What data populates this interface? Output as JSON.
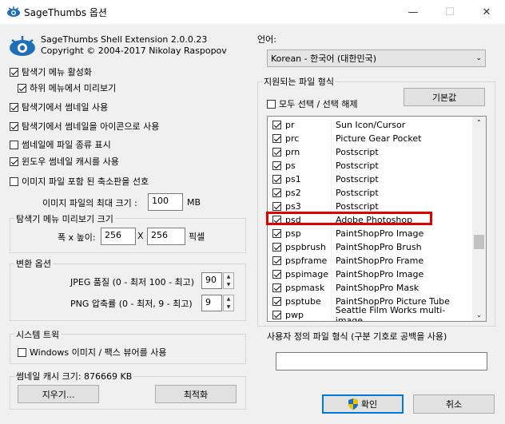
{
  "window": {
    "title": "SageThumbs 옵션",
    "minimize": "—",
    "maximize": "☐",
    "close": "✕"
  },
  "header": {
    "product": "SageThumbs Shell Extension 2.0.0.23",
    "copyright": "Copyright © 2004-2017 Nikolay Raspopov"
  },
  "options": {
    "enable_menu": {
      "label": "탐색기 메뉴 활성화",
      "checked": true
    },
    "submenu_preview": {
      "label": "하위 메뉴에서 미리보기",
      "checked": true
    },
    "use_thumbnails": {
      "label": "탐색기에서 썸네일 사용",
      "checked": true
    },
    "thumb_as_icons": {
      "label": "탐색기에서 썸네일을 아이콘으로 사용",
      "checked": true
    },
    "show_filetype": {
      "label": "썸네일에 파일 종류 표시",
      "checked": false
    },
    "windows_cache": {
      "label": "윈도우 썸네일 캐시를 사용",
      "checked": true
    },
    "prefer_embedded": {
      "label": "이미지 파일 포함 된 축소판을 선호",
      "checked": false
    }
  },
  "max_size": {
    "label": "이미지 파일의 최대 크기 :",
    "value": "100",
    "unit": "MB"
  },
  "preview_group": {
    "title": "탐색기 메뉴 미리보기 크기",
    "label": "폭 x 높이:",
    "width": "256",
    "x": "X",
    "height": "256",
    "unit": "픽셀"
  },
  "convert_group": {
    "title": "변환 옵션",
    "jpeg_label": "JPEG 품질 (0 - 최저 100 - 최고)",
    "jpeg_value": "90",
    "png_label": "PNG 압축률 (0 - 최저, 9 - 최고)",
    "png_value": "9"
  },
  "system_group": {
    "title": "시스템 트윅",
    "wiv": {
      "label": "Windows 이미지 / 팩스 뷰어를 사용",
      "checked": false
    }
  },
  "cache": {
    "label": "썸네일 캐시 크기: 876669 KB",
    "clear": "지우기...",
    "optimize": "최적화"
  },
  "language": {
    "label": "언어:",
    "value": "Korean - 한국어 (대한민국)"
  },
  "filetypes": {
    "title": "지원되는 파일 형식",
    "select_all": {
      "label": "모두 선택 / 선택 해제",
      "checked": false
    },
    "default_button": "기본값",
    "rows": [
      {
        "ext": "pr",
        "desc": "Sun Icon/Cursor",
        "checked": true
      },
      {
        "ext": "prc",
        "desc": "Picture Gear Pocket",
        "checked": true
      },
      {
        "ext": "prn",
        "desc": "Postscript",
        "checked": true
      },
      {
        "ext": "ps",
        "desc": "Postscript",
        "checked": true
      },
      {
        "ext": "ps1",
        "desc": "Postscript",
        "checked": true
      },
      {
        "ext": "ps2",
        "desc": "Postscript",
        "checked": true
      },
      {
        "ext": "ps3",
        "desc": "Postscript",
        "checked": true
      },
      {
        "ext": "psd",
        "desc": "Adobe Photoshop",
        "checked": true
      },
      {
        "ext": "psp",
        "desc": "PaintShopPro Image",
        "checked": true
      },
      {
        "ext": "pspbrush",
        "desc": "PaintShopPro Brush",
        "checked": true
      },
      {
        "ext": "pspframe",
        "desc": "PaintShopPro Frame",
        "checked": true
      },
      {
        "ext": "pspimage",
        "desc": "PaintShopPro Image",
        "checked": true
      },
      {
        "ext": "pspmask",
        "desc": "PaintShopPro Mask",
        "checked": true
      },
      {
        "ext": "psptube",
        "desc": "PaintShopPro Picture Tube",
        "checked": true
      },
      {
        "ext": "pwp",
        "desc": "Seattle Film Works multi-image",
        "checked": true
      }
    ]
  },
  "custom": {
    "label": "사용자 정의 파일 형식 (구분 기호로 공백을 사용)",
    "value": ""
  },
  "footer": {
    "ok": "확인",
    "cancel": "취소"
  },
  "colors": {
    "highlight": "#e00000",
    "accent": "#0078d7"
  }
}
